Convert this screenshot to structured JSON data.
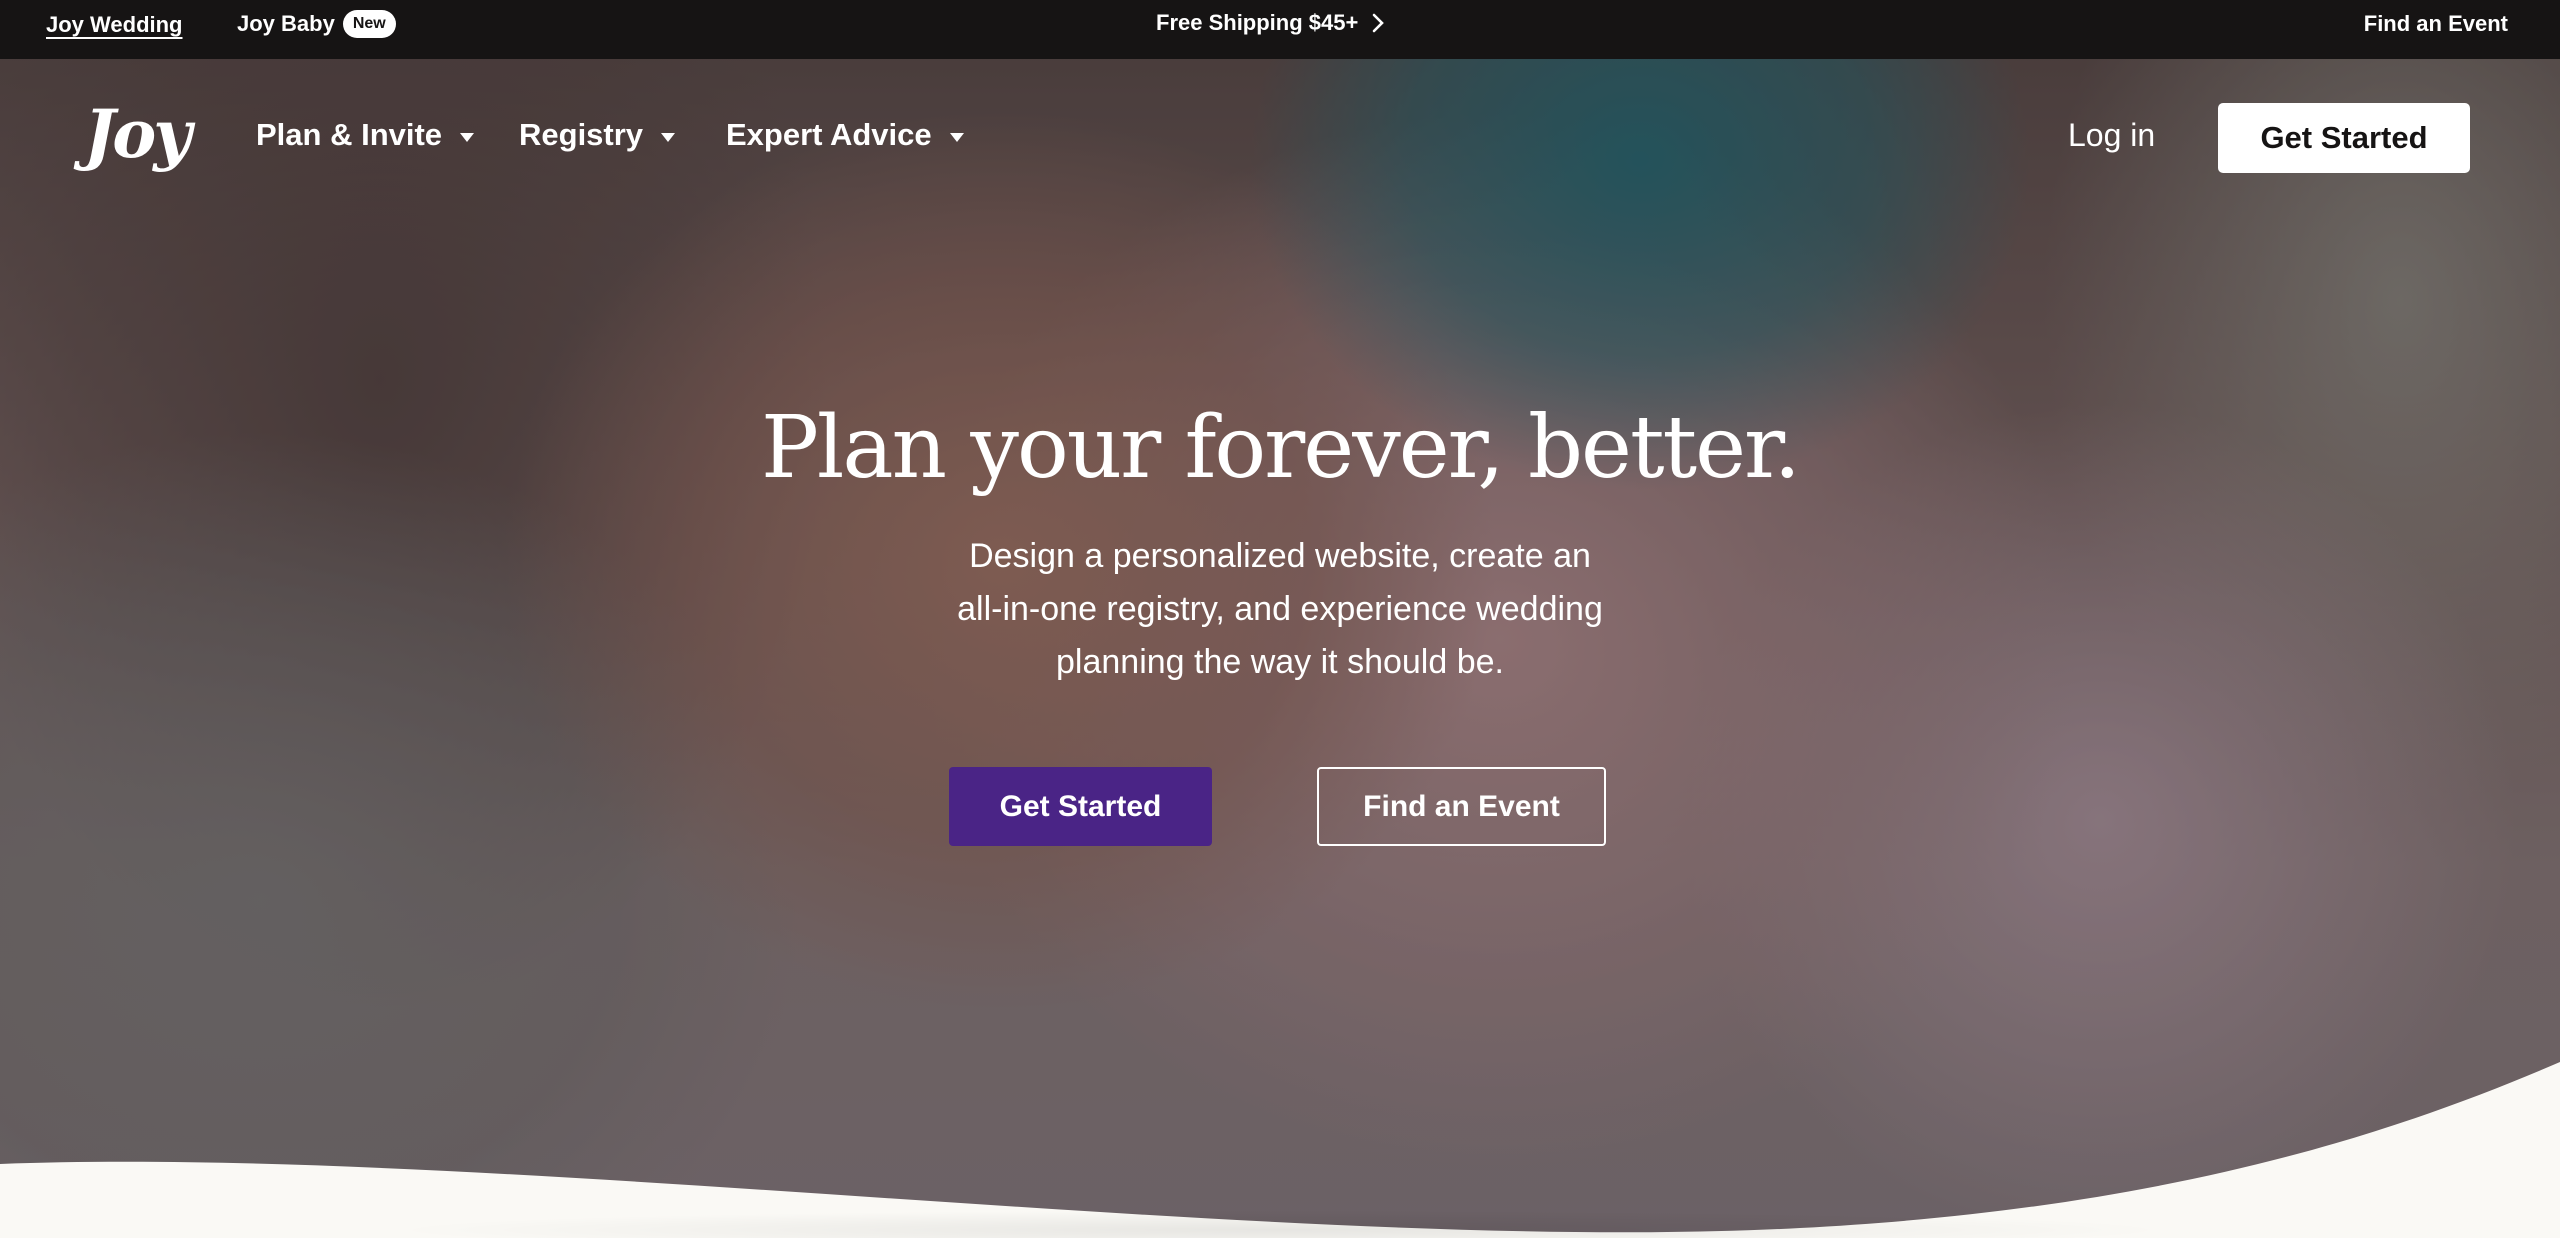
{
  "topbar": {
    "brand_link": "Joy Wedding",
    "baby_link": "Joy Baby",
    "new_badge": "New",
    "shipping": "Free Shipping $45+",
    "find_event": "Find an Event"
  },
  "nav": {
    "logo": "Joy",
    "items": [
      {
        "label": "Plan & Invite",
        "icon": "chevron-down-icon"
      },
      {
        "label": "Registry",
        "icon": "chevron-down-icon"
      },
      {
        "label": "Expert Advice",
        "icon": "chevron-down-icon"
      }
    ],
    "login": "Log in",
    "cta": "Get Started"
  },
  "hero": {
    "headline": "Plan your forever, better.",
    "subcopy_lines": [
      "Design a personalized website, create an",
      "all-in-one registry, and experience wedding",
      "planning the way it should be."
    ],
    "primary_button": "Get Started",
    "secondary_button": "Find an Event"
  },
  "colors": {
    "topbar_bg": "#161414",
    "primary_button": "#4a2486",
    "page_bg": "#faf9f5"
  }
}
